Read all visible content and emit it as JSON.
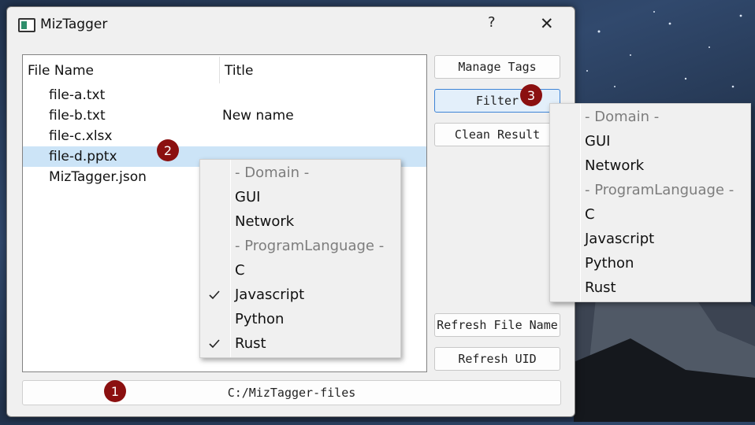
{
  "window": {
    "title": "MizTagger",
    "help_label": "?",
    "close_label": "✕"
  },
  "file_tree": {
    "columns": [
      "File Name",
      "Title"
    ],
    "rows": [
      {
        "name": "file-a.txt",
        "title": ""
      },
      {
        "name": "file-b.txt",
        "title": "New name"
      },
      {
        "name": "file-c.xlsx",
        "title": ""
      },
      {
        "name": "file-d.pptx",
        "title": "",
        "selected": true
      },
      {
        "name": "MizTagger.json",
        "title": ""
      }
    ]
  },
  "buttons": {
    "manage_tags": "Manage Tags",
    "filter": "Filter",
    "clean_result": "Clean Result",
    "refresh_file_name": "Refresh File Name",
    "refresh_uid": "Refresh UID"
  },
  "path_bar": {
    "value": "C:/MizTagger-files"
  },
  "context_menu": {
    "items": [
      {
        "label": "- Domain -",
        "type": "section",
        "checked": false
      },
      {
        "label": "GUI",
        "type": "item",
        "checked": false
      },
      {
        "label": "Network",
        "type": "item",
        "checked": false
      },
      {
        "label": "- ProgramLanguage -",
        "type": "section",
        "checked": false
      },
      {
        "label": "C",
        "type": "item",
        "checked": false
      },
      {
        "label": "Javascript",
        "type": "item",
        "checked": true
      },
      {
        "label": "Python",
        "type": "item",
        "checked": false
      },
      {
        "label": "Rust",
        "type": "item",
        "checked": true
      }
    ]
  },
  "filter_menu": {
    "items": [
      {
        "label": "- Domain -",
        "type": "section",
        "checked": false
      },
      {
        "label": "GUI",
        "type": "item",
        "checked": false
      },
      {
        "label": "Network",
        "type": "item",
        "checked": false
      },
      {
        "label": "- ProgramLanguage -",
        "type": "section",
        "checked": false
      },
      {
        "label": "C",
        "type": "item",
        "checked": false
      },
      {
        "label": "Javascript",
        "type": "item",
        "checked": false
      },
      {
        "label": "Python",
        "type": "item",
        "checked": false
      },
      {
        "label": "Rust",
        "type": "item",
        "checked": false
      }
    ]
  },
  "badges": [
    "1",
    "2",
    "3"
  ],
  "colors": {
    "selection": "#cce4f7",
    "badge": "#8b1010",
    "section_text": "#7d7d7d",
    "focus_border": "#3e84d6"
  }
}
